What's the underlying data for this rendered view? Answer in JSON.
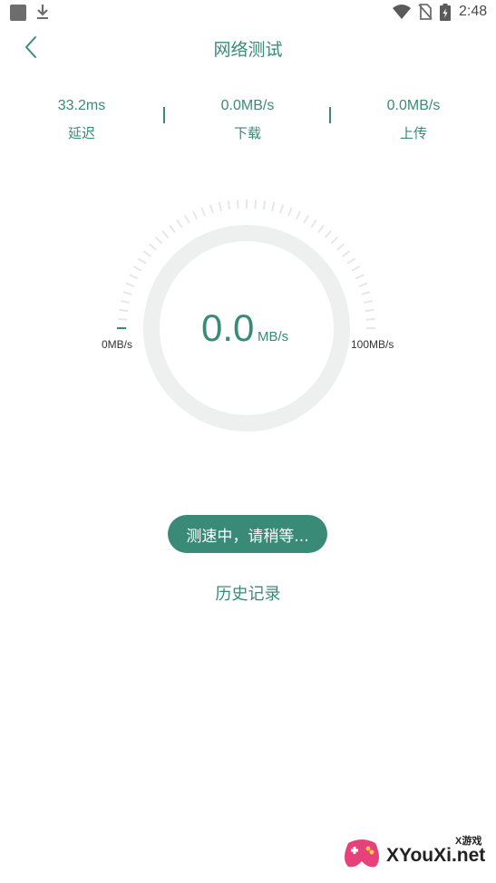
{
  "status_bar": {
    "time": "2:48",
    "icons": [
      "app-notification-icon",
      "download-icon",
      "wifi-icon",
      "no-sim-icon",
      "battery-icon"
    ]
  },
  "header": {
    "back_icon": "chevron-left-icon",
    "title": "网络测试"
  },
  "stats": [
    {
      "value": "33.2ms",
      "label": "延迟"
    },
    {
      "value": "0.0MB/s",
      "label": "下载"
    },
    {
      "value": "0.0MB/s",
      "label": "上传"
    }
  ],
  "gauge": {
    "speed": "0.0",
    "unit": "MB/s",
    "min_label": "0MB/s",
    "max_label": "100MB/s",
    "progress": 0
  },
  "actions": {
    "test_button": "测速中，请稍等...",
    "history": "历史记录"
  },
  "watermark": {
    "text": "XYouXi.net",
    "small": "X游戏"
  },
  "colors": {
    "accent": "#3a8a78",
    "ring": "#eef0f0",
    "ticks": "#e6e8e8",
    "text_dark": "#333333"
  }
}
